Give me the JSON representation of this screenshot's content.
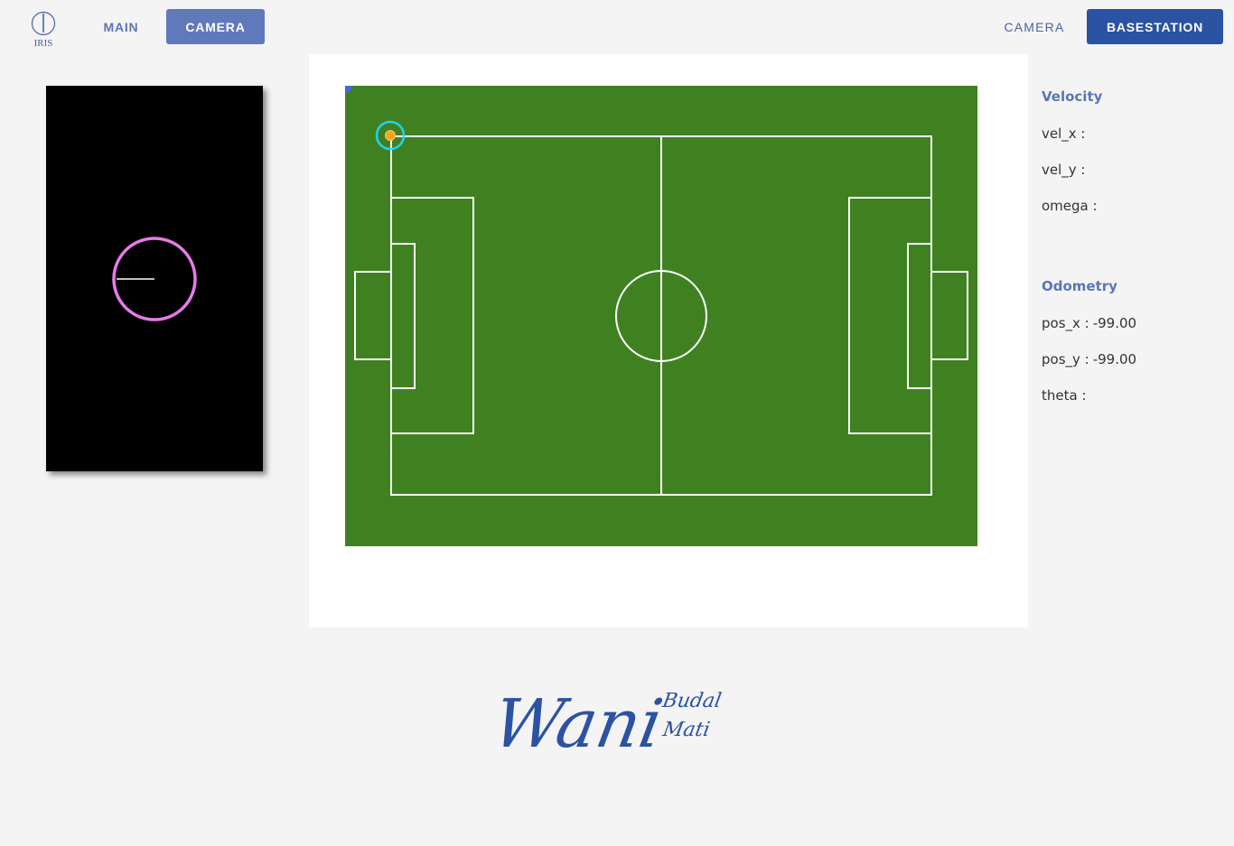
{
  "nav": {
    "logo_text": "IRIS",
    "main_label": "MAIN",
    "camera_label": "CAMERA",
    "camera_right_label": "CAMERA",
    "basestation_label": "BASESTATION"
  },
  "colors": {
    "accent": "#5b76b8",
    "brand_dark": "#2c52a3",
    "field_green": "#3f8121",
    "robot_ring": "#22d3ee",
    "ball": "#f5a623",
    "omni_ring": "#e87ae8"
  },
  "velocity": {
    "heading": "Velocity",
    "vel_x_label": "vel_x :",
    "vel_x_value": "",
    "vel_y_label": "vel_y :",
    "vel_y_value": "",
    "omega_label": "omega :",
    "omega_value": ""
  },
  "odometry": {
    "heading": "Odometry",
    "pos_x_label": "pos_x :",
    "pos_x_value": "-99.00",
    "pos_y_label": "pos_y :",
    "pos_y_value": "-99.00",
    "theta_label": "theta :",
    "theta_value": ""
  },
  "signature": {
    "main": "Wani",
    "line1": "Budal",
    "line2": "Mati"
  }
}
